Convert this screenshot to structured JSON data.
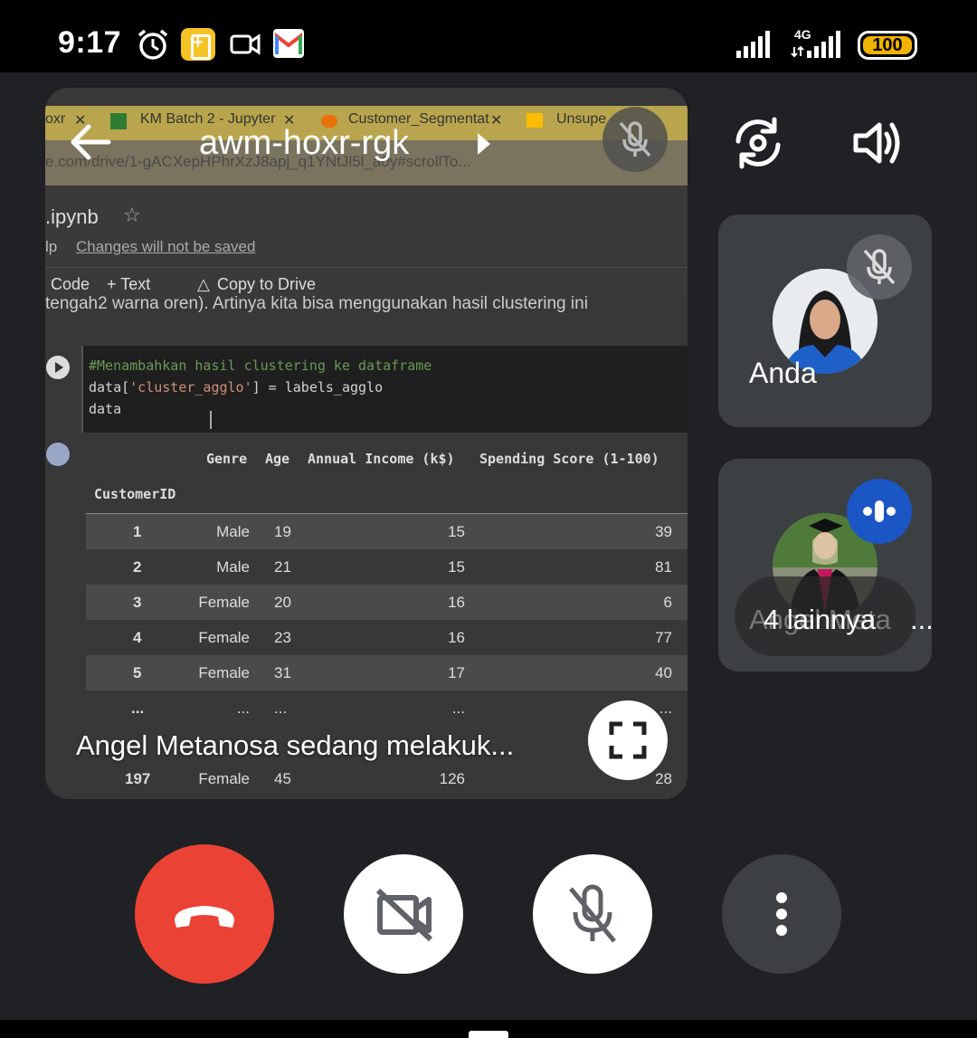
{
  "status_bar": {
    "time": "9:17",
    "battery": "100",
    "network": "4G",
    "icons": [
      "alarm-icon",
      "notes-app-icon",
      "video-icon",
      "gmail-icon",
      "signal-icon",
      "signal-4g-icon",
      "battery-icon"
    ]
  },
  "main_tile": {
    "meeting_code": "awm-hoxr-rgk",
    "caption": "Angel Metanosa sedang melakuk...",
    "browser": {
      "tabs": [
        "oxr",
        "KM Batch 2 - Jupyter",
        "Customer_Segmentat",
        "Unsupe"
      ],
      "tab_close": "✕",
      "url": "e.com/drive/1-gACXepHPhrXzJ8apj_q1YNtJl5l_a0y#scrollTo..."
    },
    "colab": {
      "notebook_name": ".ipynb",
      "help": "lp",
      "unsaved": "Changes will not be saved",
      "toolbar": [
        "Code",
        "+ Text",
        "Copy to Drive"
      ],
      "text_line": "tengah2 warna oren). Artinya kita bisa menggunakan hasil clustering ini",
      "code_comment": "#Menambahkan hasil clustering ke dataframe",
      "code_line2_a": "data[",
      "code_line2_str": "'cluster_agglo'",
      "code_line2_b": "] = labels_agglo",
      "code_line3": "data"
    },
    "dataframe": {
      "columns": [
        "Genre",
        "Age",
        "Annual Income (k$)",
        "Spending Score (1-100)"
      ],
      "index_name": "CustomerID",
      "rows": [
        {
          "id": "1",
          "genre": "Male",
          "age": "19",
          "income": "15",
          "score": "39"
        },
        {
          "id": "2",
          "genre": "Male",
          "age": "21",
          "income": "15",
          "score": "81"
        },
        {
          "id": "3",
          "genre": "Female",
          "age": "20",
          "income": "16",
          "score": "6"
        },
        {
          "id": "4",
          "genre": "Female",
          "age": "23",
          "income": "16",
          "score": "77"
        },
        {
          "id": "5",
          "genre": "Female",
          "age": "31",
          "income": "17",
          "score": "40"
        },
        {
          "id": "...",
          "genre": "...",
          "age": "...",
          "income": "...",
          "score": "..."
        },
        {
          "id": "197",
          "genre": "Female",
          "age": "45",
          "income": "126",
          "score": "28"
        }
      ]
    }
  },
  "participants": {
    "self_name": "Anda",
    "others_label": "4 lainnya",
    "others_ghost": "Angel Meta",
    "others_ellipsis": "..."
  },
  "colors": {
    "hangup": "#ea4335",
    "speaking_badge": "#1a56c4",
    "tile_bg": "#3c4043",
    "background": "#202124"
  }
}
